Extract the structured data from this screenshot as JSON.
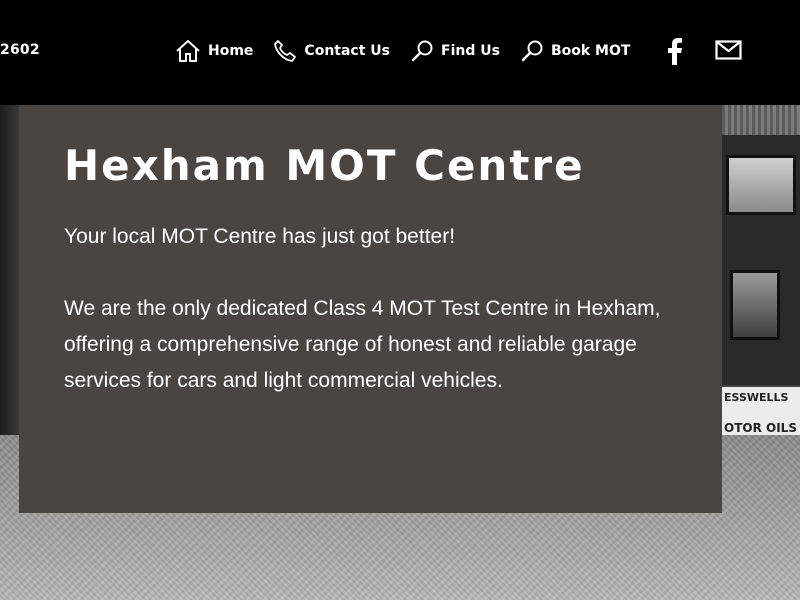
{
  "header": {
    "phone": "2602",
    "nav": [
      {
        "label": "Home",
        "icon": "home-icon"
      },
      {
        "label": "Contact Us",
        "icon": "phone-icon"
      },
      {
        "label": "Find Us",
        "icon": "search-icon"
      },
      {
        "label": "Book MOT",
        "icon": "search-icon"
      }
    ],
    "social": {
      "facebook_icon": "facebook-icon",
      "mail_icon": "mail-icon"
    }
  },
  "hero": {
    "title": "Hexham MOT Centre",
    "subtitle": "Your local MOT Centre has just got better!",
    "description": "We are the only dedicated Class 4 MOT Test Centre in Hexham, offering a comprehensive range of honest and reliable garage services for cars and light commercial vehicles."
  },
  "background_sign": {
    "line1": "ESSWELLS",
    "line3": "OTOR OILS"
  },
  "colors": {
    "header_bg": "#000000",
    "panel_bg": "#4b4542",
    "text": "#ffffff"
  }
}
